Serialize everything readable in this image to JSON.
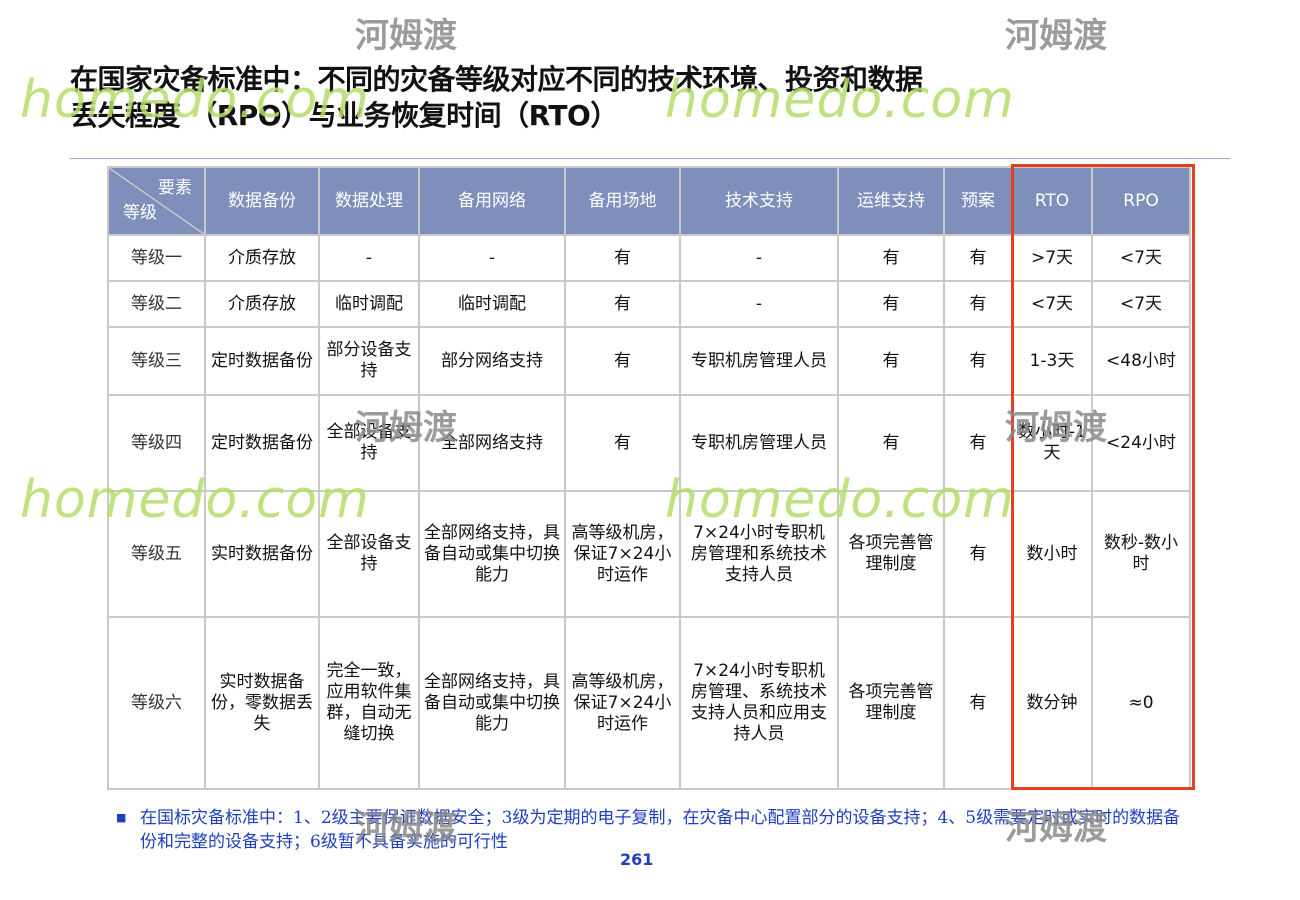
{
  "title_line1": "在国家灾备标准中：不同的灾备等级对应不同的技术环境、投资和数据",
  "title_line2": "丢失程度 （RPO）与业务恢复时间（RTO）",
  "corner_top": "要素",
  "corner_bottom": "等级",
  "headers": [
    "数据备份",
    "数据处理",
    "备用网络",
    "备用场地",
    "技术支持",
    "运维支持",
    "预案",
    "RTO",
    "RPO"
  ],
  "rows": [
    {
      "level": "等级一",
      "cells": [
        "介质存放",
        "-",
        "-",
        "有",
        "-",
        "有",
        "有",
        ">7天",
        "<7天"
      ]
    },
    {
      "level": "等级二",
      "cells": [
        "介质存放",
        "临时调配",
        "临时调配",
        "有",
        "-",
        "有",
        "有",
        "<7天",
        "<7天"
      ]
    },
    {
      "level": "等级三",
      "cells": [
        "定时数据备份",
        "部分设备支持",
        "部分网络支持",
        "有",
        "专职机房管理人员",
        "有",
        "有",
        "1-3天",
        "<48小时"
      ]
    },
    {
      "level": "等级四",
      "cells": [
        "定时数据备份",
        "全部设备支持",
        "全部网络支持",
        "有",
        "专职机房管理人员",
        "有",
        "有",
        "数小时-1天",
        "<24小时"
      ]
    },
    {
      "level": "等级五",
      "cells": [
        "实时数据备份",
        "全部设备支持",
        "全部网络支持，具备自动或集中切换能力",
        "高等级机房，保证7×24小时运作",
        "7×24小时专职机房管理和系统技术支持人员",
        "各项完善管理制度",
        "有",
        "数小时",
        "数秒-数小时"
      ]
    },
    {
      "level": "等级六",
      "cells": [
        "实时数据备份，零数据丢失",
        "完全一致，应用软件集群，自动无缝切换",
        "全部网络支持，具备自动或集中切换能力",
        "高等级机房，保证7×24小时运作",
        "7×24小时专职机房管理、系统技术支持人员和应用支持人员",
        "各项完善管理制度",
        "有",
        "数分钟",
        "≈0"
      ]
    }
  ],
  "note": "在国标灾备标准中：1、2级主要保证数据安全；3级为定期的电子复制，在灾备中心配置部分的设备支持；4、5级需要定时或实时的数据备份和完整的设备支持；6级暂不具备实施的可行性",
  "page_number": "261",
  "watermark_en": "homedo.com",
  "watermark_cn": "河姆渡",
  "colors": {
    "header_bg": "#7f8fbc",
    "highlight_border": "#e2401f",
    "note_text": "#1d3fc0"
  }
}
